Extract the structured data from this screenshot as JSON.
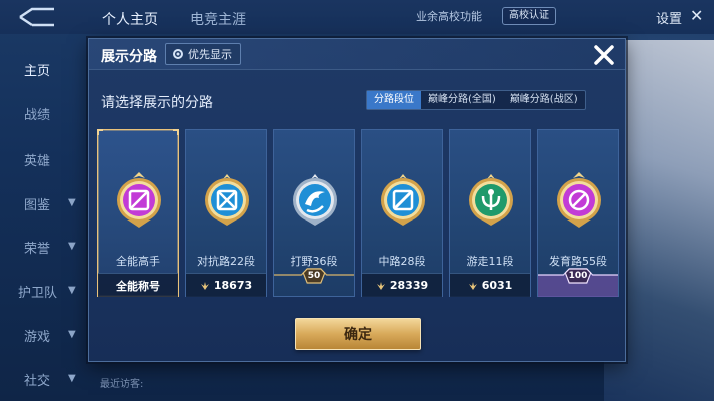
{
  "app": {
    "tabs": [
      "个人主页",
      "电竞主涯"
    ],
    "campus_func": "业余高校功能",
    "campus_badge": "高校认证",
    "settings": "设置",
    "sidebar": [
      "主页",
      "战绩",
      "英雄",
      "图鉴",
      "荣誉",
      "护卫队",
      "游戏",
      "社交"
    ],
    "visitors": "最近访客:"
  },
  "modal": {
    "title": "展示分路",
    "priority_label": "优先显示",
    "subtitle": "请选择展示的分路",
    "tabs": [
      {
        "label": "分路段位",
        "active": true
      },
      {
        "label": "巅峰分路(全国)",
        "active": false
      },
      {
        "label": "巅峰分路(战区)",
        "active": false
      }
    ],
    "cards": [
      {
        "name": "全能高手",
        "foot_text": "全能称号",
        "emblem": "allround-emblem-icon",
        "color": "#c23bd6",
        "selected": true
      },
      {
        "name": "对抗路22段",
        "foot_value": "18673",
        "emblem": "clash-lane-emblem-icon",
        "color": "#1f8fd6",
        "selected": false
      },
      {
        "name": "打野36段",
        "level": "50",
        "emblem": "jungle-emblem-icon",
        "color": "#1f8fd6",
        "selected": false
      },
      {
        "name": "中路28段",
        "foot_value": "28339",
        "emblem": "mid-lane-emblem-icon",
        "color": "#1f8fd6",
        "selected": false
      },
      {
        "name": "游走11段",
        "foot_value": "6031",
        "emblem": "roam-emblem-icon",
        "color": "#1f9a6b",
        "selected": false
      },
      {
        "name": "发育路55段",
        "level": "100",
        "emblem": "farm-lane-emblem-icon",
        "color": "#c23bd6",
        "selected": false
      }
    ],
    "confirm_label": "确定"
  }
}
